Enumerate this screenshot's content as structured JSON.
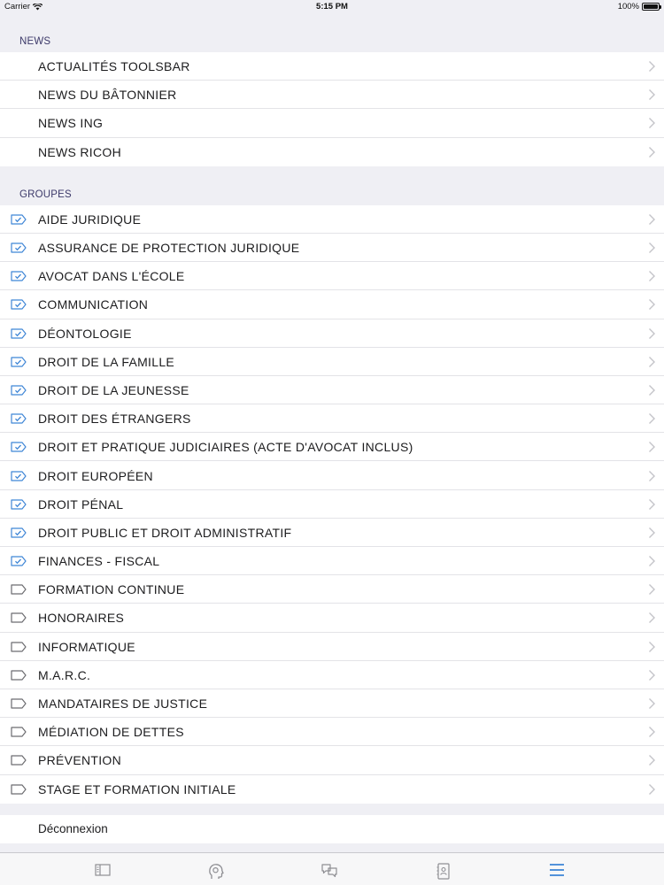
{
  "status_bar": {
    "carrier": "Carrier",
    "time": "5:15 PM",
    "battery": "100%"
  },
  "news": {
    "header": "NEWS",
    "items": [
      {
        "label": "ACTUALITÉS TOOLSBAR"
      },
      {
        "label": "NEWS DU BÂTONNIER"
      },
      {
        "label": "NEWS ING"
      },
      {
        "label": "NEWS RICOH"
      }
    ]
  },
  "groups": {
    "header": "GROUPES",
    "items": [
      {
        "label": "AIDE JURIDIQUE",
        "subscribed": true
      },
      {
        "label": "ASSURANCE DE PROTECTION JURIDIQUE",
        "subscribed": true
      },
      {
        "label": "AVOCAT DANS L'ÉCOLE",
        "subscribed": true
      },
      {
        "label": "COMMUNICATION",
        "subscribed": true
      },
      {
        "label": "DÉONTOLOGIE",
        "subscribed": true
      },
      {
        "label": "DROIT DE LA FAMILLE",
        "subscribed": true
      },
      {
        "label": "DROIT DE LA JEUNESSE",
        "subscribed": true
      },
      {
        "label": "DROIT DES ÉTRANGERS",
        "subscribed": true
      },
      {
        "label": "DROIT ET PRATIQUE JUDICIAIRES (ACTE D'AVOCAT INCLUS)",
        "subscribed": true
      },
      {
        "label": "DROIT EUROPÉEN",
        "subscribed": true
      },
      {
        "label": "DROIT PÉNAL",
        "subscribed": true
      },
      {
        "label": "DROIT PUBLIC ET DROIT ADMINISTRATIF",
        "subscribed": true
      },
      {
        "label": "FINANCES - FISCAL",
        "subscribed": true
      },
      {
        "label": "FORMATION CONTINUE",
        "subscribed": false
      },
      {
        "label": "HONORAIRES",
        "subscribed": false
      },
      {
        "label": "INFORMATIQUE",
        "subscribed": false
      },
      {
        "label": "M.A.R.C.",
        "subscribed": false
      },
      {
        "label": "MANDATAIRES DE JUSTICE",
        "subscribed": false
      },
      {
        "label": "MÉDIATION DE DETTES",
        "subscribed": false
      },
      {
        "label": "PRÉVENTION",
        "subscribed": false
      },
      {
        "label": "STAGE ET FORMATION INITIALE",
        "subscribed": false
      }
    ]
  },
  "logout": {
    "label": "Déconnexion"
  },
  "tab_bar": {
    "tabs": [
      {
        "icon": "book-icon",
        "selected": false
      },
      {
        "icon": "head-profile-icon",
        "selected": false
      },
      {
        "icon": "chat-bubbles-icon",
        "selected": false
      },
      {
        "icon": "contacts-icon",
        "selected": false
      },
      {
        "icon": "menu-icon",
        "selected": true
      }
    ]
  },
  "colors": {
    "accent": "#3f86d6",
    "section_text": "#3d3a6a",
    "background": "#efeff4",
    "inactive_icon": "#8e8e93"
  }
}
